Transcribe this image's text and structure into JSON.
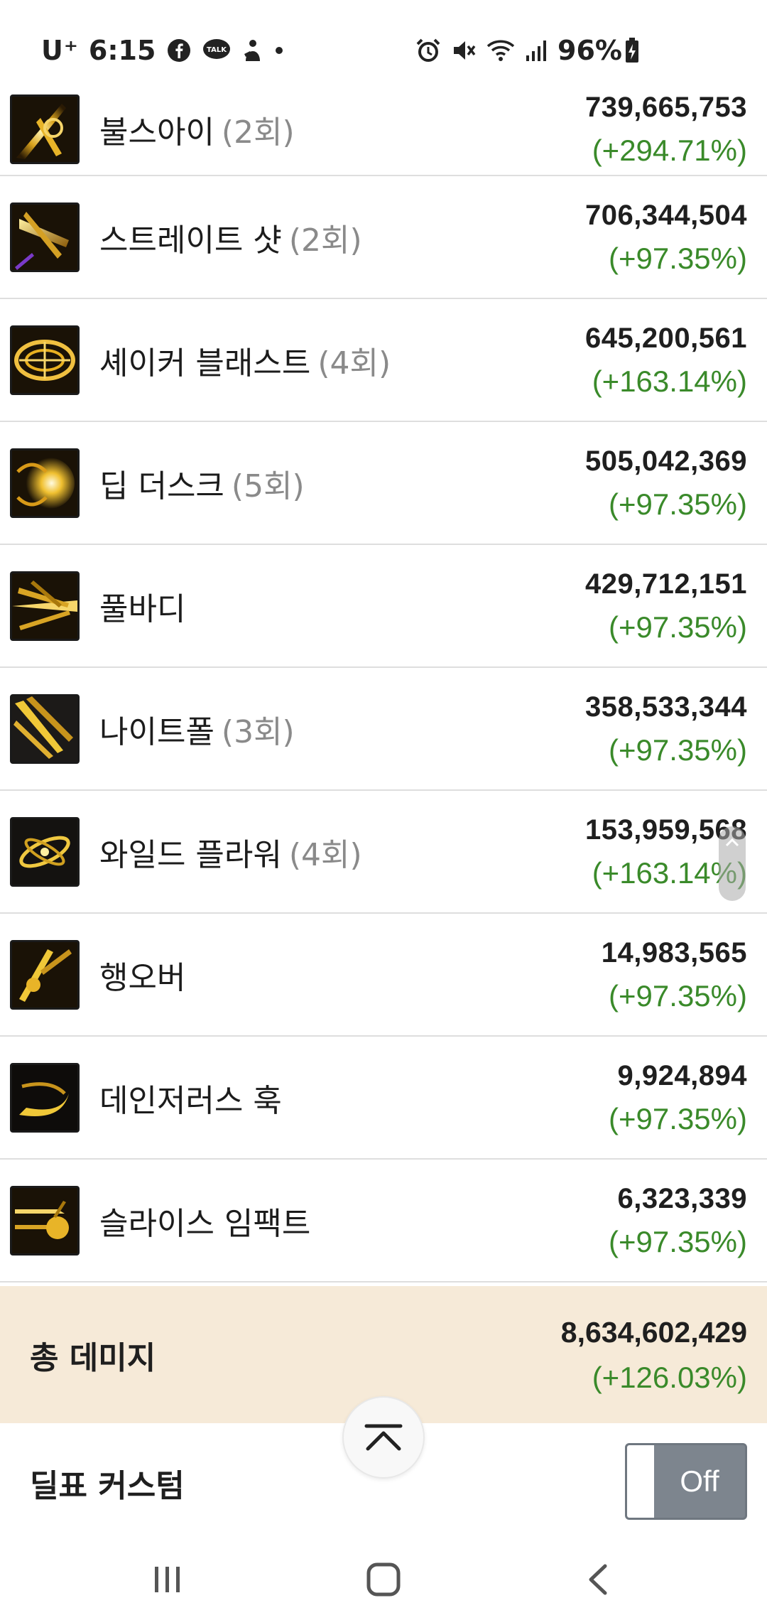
{
  "status_bar": {
    "carrier": "U⁺",
    "time": "6:15",
    "battery": "96%",
    "icons": [
      "facebook-icon",
      "kakaotalk-icon",
      "notification-app-icon",
      "more-dot-icon",
      "alarm-icon",
      "mute-icon",
      "wifi-icon",
      "signal-icon",
      "battery-charging-icon"
    ]
  },
  "skills": [
    {
      "name": "불스아이",
      "count": "(2회)",
      "damage": "739,665,753",
      "pct": "(+294.71%)",
      "icon": "bullseye-skill-icon"
    },
    {
      "name": "스트레이트 샷",
      "count": "(2회)",
      "damage": "706,344,504",
      "pct": "(+97.35%)",
      "icon": "straight-shot-skill-icon"
    },
    {
      "name": "셰이커 블래스트",
      "count": "(4회)",
      "damage": "645,200,561",
      "pct": "(+163.14%)",
      "icon": "shaker-blast-skill-icon"
    },
    {
      "name": "딥 더스크",
      "count": "(5회)",
      "damage": "505,042,369",
      "pct": "(+97.35%)",
      "icon": "deep-dusk-skill-icon"
    },
    {
      "name": "풀바디",
      "count": "",
      "damage": "429,712,151",
      "pct": "(+97.35%)",
      "icon": "full-body-skill-icon"
    },
    {
      "name": "나이트폴",
      "count": "(3회)",
      "damage": "358,533,344",
      "pct": "(+97.35%)",
      "icon": "nightfall-skill-icon"
    },
    {
      "name": "와일드 플라워",
      "count": "(4회)",
      "damage": "153,959,568",
      "pct": "(+163.14%)",
      "icon": "wild-flower-skill-icon"
    },
    {
      "name": "행오버",
      "count": "",
      "damage": "14,983,565",
      "pct": "(+97.35%)",
      "icon": "hangover-skill-icon"
    },
    {
      "name": "데인저러스 훅",
      "count": "",
      "damage": "9,924,894",
      "pct": "(+97.35%)",
      "icon": "dangerous-hook-skill-icon"
    },
    {
      "name": "슬라이스 임팩트",
      "count": "",
      "damage": "6,323,339",
      "pct": "(+97.35%)",
      "icon": "slice-impact-skill-icon"
    }
  ],
  "total": {
    "label": "총 데미지",
    "damage": "8,634,602,429",
    "pct": "(+126.03%)"
  },
  "custom": {
    "label": "딜표 커스텀",
    "toggle_label": "Off",
    "toggle_on": false
  },
  "colors": {
    "percent_green": "#3a8a2a",
    "total_bg": "#f6ead8",
    "toggle_off": "#7d858e"
  }
}
